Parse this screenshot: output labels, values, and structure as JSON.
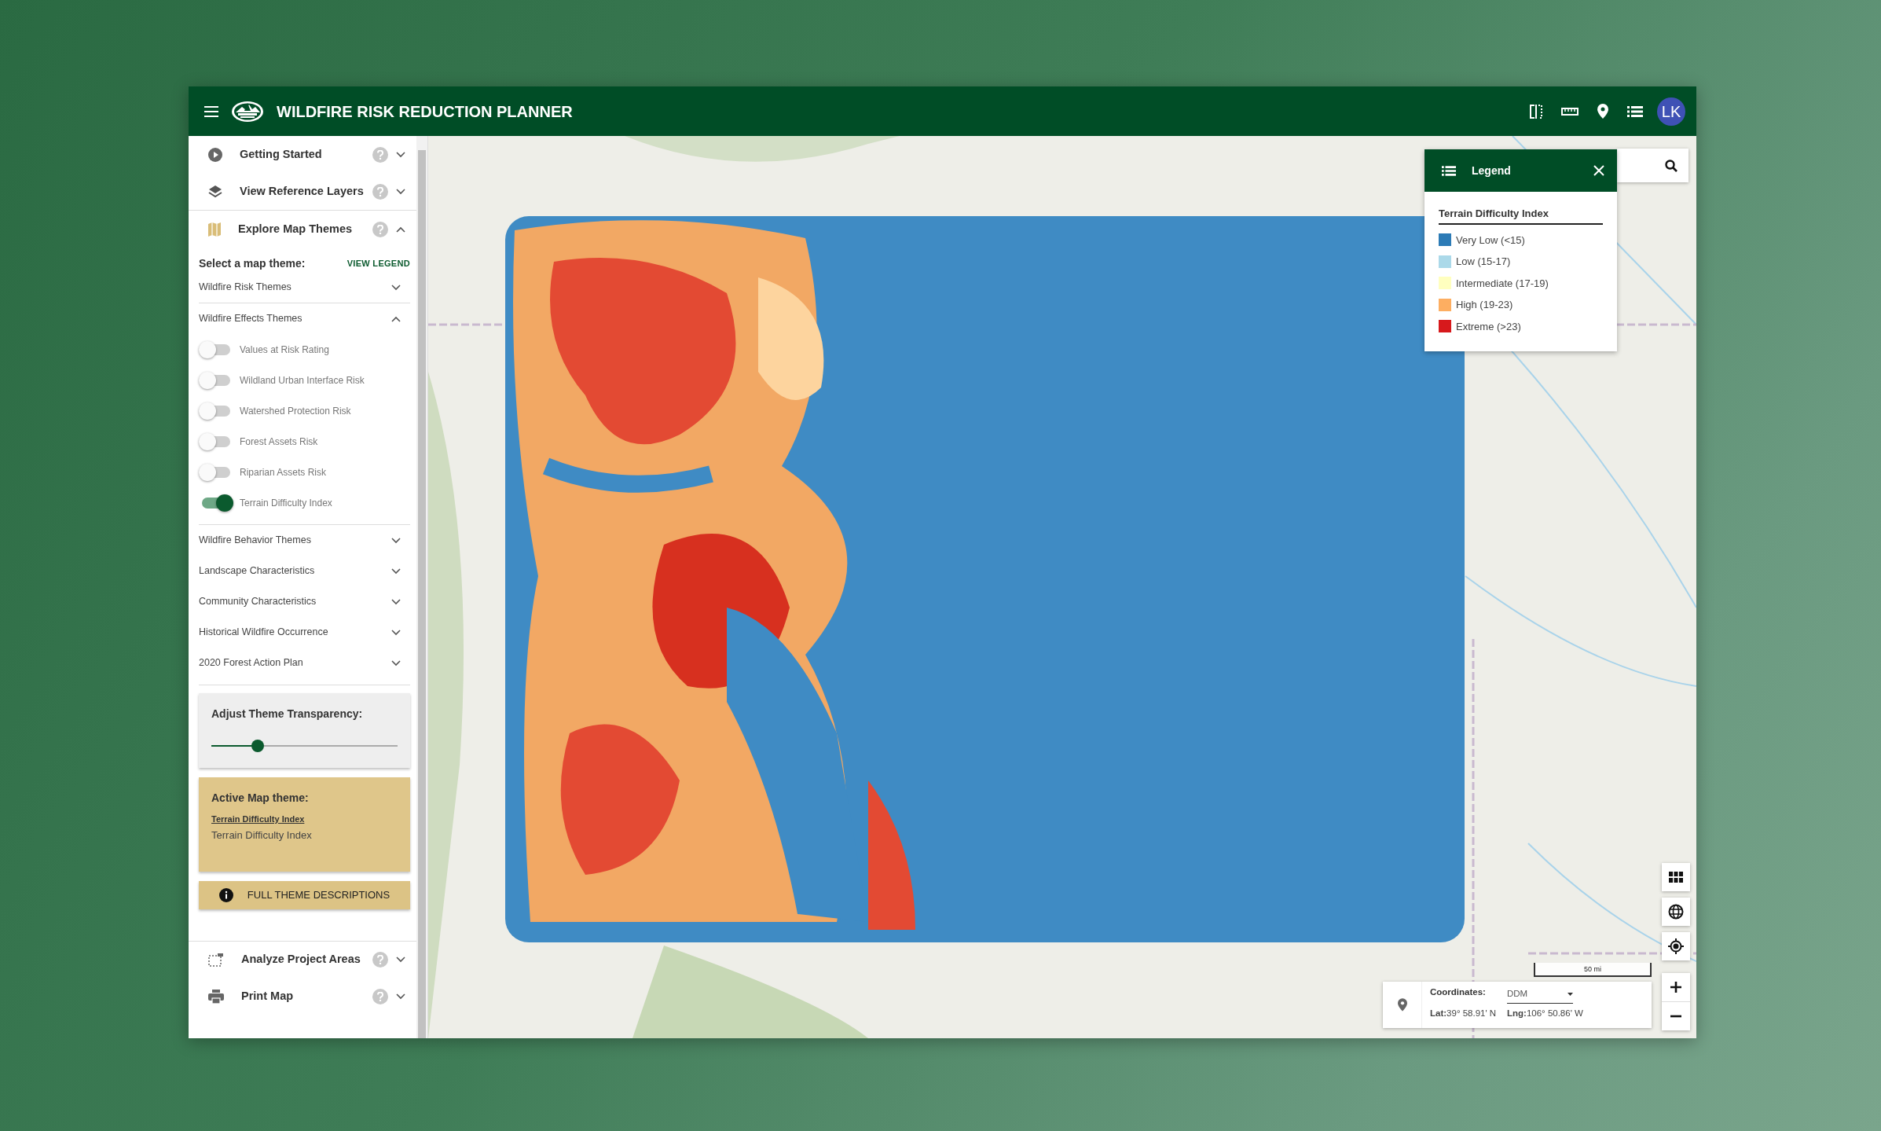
{
  "header": {
    "title": "WILDFIRE RISK REDUCTION PLANNER",
    "avatar": "LK"
  },
  "sidebar": {
    "sections_top": [
      {
        "title": "Getting Started",
        "kind": "play",
        "expanded": false
      },
      {
        "title": "View Reference Layers",
        "kind": "layers",
        "expanded": false
      },
      {
        "title": "Explore Map Themes",
        "kind": "map",
        "expanded": true
      }
    ],
    "prompt": "Select a map theme:",
    "legend_link": "VIEW LEGEND",
    "groups": [
      {
        "title": "Wildfire Risk Themes",
        "expanded": false
      },
      {
        "title": "Wildfire Effects Themes",
        "expanded": true,
        "themes": [
          {
            "label": "Values at Risk Rating",
            "on": false
          },
          {
            "label": "Wildland Urban Interface Risk",
            "on": false
          },
          {
            "label": "Watershed Protection Risk",
            "on": false
          },
          {
            "label": "Forest Assets Risk",
            "on": false
          },
          {
            "label": "Riparian Assets Risk",
            "on": false
          },
          {
            "label": "Terrain Difficulty Index",
            "on": true
          }
        ]
      },
      {
        "title": "Wildfire Behavior Themes",
        "expanded": false
      },
      {
        "title": "Landscape Characteristics",
        "expanded": false
      },
      {
        "title": "Community Characteristics",
        "expanded": false
      },
      {
        "title": "Historical Wildfire Occurrence",
        "expanded": false
      },
      {
        "title": "2020 Forest Action Plan",
        "expanded": false
      }
    ],
    "transparency": {
      "title": "Adjust Theme Transparency:",
      "level": 0.25
    },
    "active_theme": {
      "heading": "Active Map theme:",
      "link": "Terrain Difficulty Index",
      "description": "Terrain Difficulty Index"
    },
    "descriptions_button": "FULL THEME DESCRIPTIONS",
    "sections_bottom": [
      {
        "title": "Analyze Project Areas",
        "kind": "select",
        "expanded": false
      },
      {
        "title": "Print Map",
        "kind": "print",
        "expanded": false
      }
    ]
  },
  "legend": {
    "title": "Legend",
    "layer": "Terrain Difficulty Index",
    "items": [
      {
        "label": "Very Low (<15)",
        "color": "#2c7bb6"
      },
      {
        "label": "Low (15-17)",
        "color": "#abd9e9"
      },
      {
        "label": "Intermediate (17-19)",
        "color": "#ffffbf"
      },
      {
        "label": "High (19-23)",
        "color": "#fdae61"
      },
      {
        "label": "Extreme (>23)",
        "color": "#d7191c"
      }
    ]
  },
  "scale": "50 mi",
  "coordinates": {
    "label": "Coordinates:",
    "format": "DDM",
    "lat": "**Lat:**39° 58.91' N",
    "lng": "**Lng:**106° 50.86' W"
  }
}
